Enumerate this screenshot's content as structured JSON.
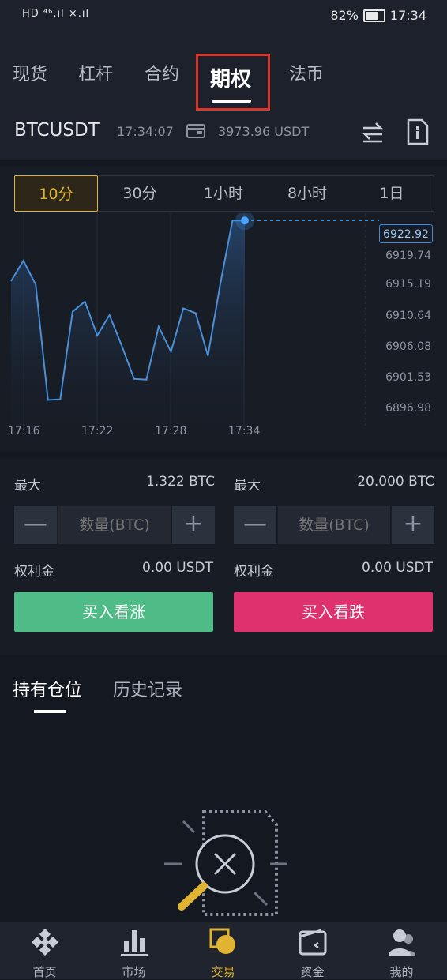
{
  "status_bar": {
    "network": "HD ⁴⁶.ıl ×.ıl",
    "battery": "82%",
    "time": "17:34"
  },
  "tabs": [
    {
      "label": "现货"
    },
    {
      "label": "杠杆"
    },
    {
      "label": "合约"
    },
    {
      "label": "期权",
      "active": true
    },
    {
      "label": "法币"
    }
  ],
  "ticker": {
    "pair": "BTCUSDT",
    "time": "17:34:07",
    "balance": "3973.96 USDT"
  },
  "intervals": [
    "10分",
    "30分",
    "1小时",
    "8小时",
    "1日"
  ],
  "chart_data": {
    "type": "line",
    "x": [
      "17:15",
      "17:16",
      "17:17",
      "17:18",
      "17:19",
      "17:20",
      "17:21",
      "17:22",
      "17:23",
      "17:24",
      "17:25",
      "17:26",
      "17:27",
      "17:28",
      "17:29",
      "17:30",
      "17:31",
      "17:32",
      "17:33",
      "17:34"
    ],
    "y": [
      6914.0,
      6917.0,
      6913.5,
      6896.5,
      6896.6,
      6909.5,
      6911.0,
      6906.0,
      6909.0,
      6904.5,
      6899.6,
      6899.5,
      6907.3,
      6903.6,
      6910.0,
      6909.3,
      6903.0,
      6913.5,
      6922.92,
      6922.92
    ],
    "x_tick_labels": [
      "17:16",
      "17:22",
      "17:28",
      "17:34"
    ],
    "y_tick_labels": [
      "6919.74",
      "6915.19",
      "6910.64",
      "6906.08",
      "6901.53",
      "6896.98"
    ],
    "last_price": "6922.92",
    "ylim": [
      6894.0,
      6924.0
    ],
    "line_color": "#4a8fd8"
  },
  "trade": {
    "call": {
      "max_label": "最大",
      "max_value": "1.322 BTC",
      "qty_placeholder": "数量(BTC)",
      "premium_label": "权利金",
      "premium_value": "0.00 USDT",
      "buy_label": "买入看涨",
      "color": "#4fbc87"
    },
    "put": {
      "max_label": "最大",
      "max_value": "20.000 BTC",
      "qty_placeholder": "数量(BTC)",
      "premium_label": "权利金",
      "premium_value": "0.00 USDT",
      "buy_label": "买入看跌",
      "color": "#e0316f"
    },
    "minus": "—",
    "plus": "+"
  },
  "positions": {
    "tabs": [
      {
        "label": "持有仓位",
        "active": true
      },
      {
        "label": "历史记录"
      }
    ]
  },
  "nav": [
    {
      "label": "首页",
      "icon": "home-diamond-icon"
    },
    {
      "label": "市场",
      "icon": "market-bars-icon"
    },
    {
      "label": "交易",
      "icon": "trade-icon",
      "active": true
    },
    {
      "label": "资金",
      "icon": "wallet-icon"
    },
    {
      "label": "我的",
      "icon": "profile-icon"
    }
  ],
  "colors": {
    "accent": "#e0b332",
    "background": "#141821",
    "highlight_box": "#d9372b"
  }
}
